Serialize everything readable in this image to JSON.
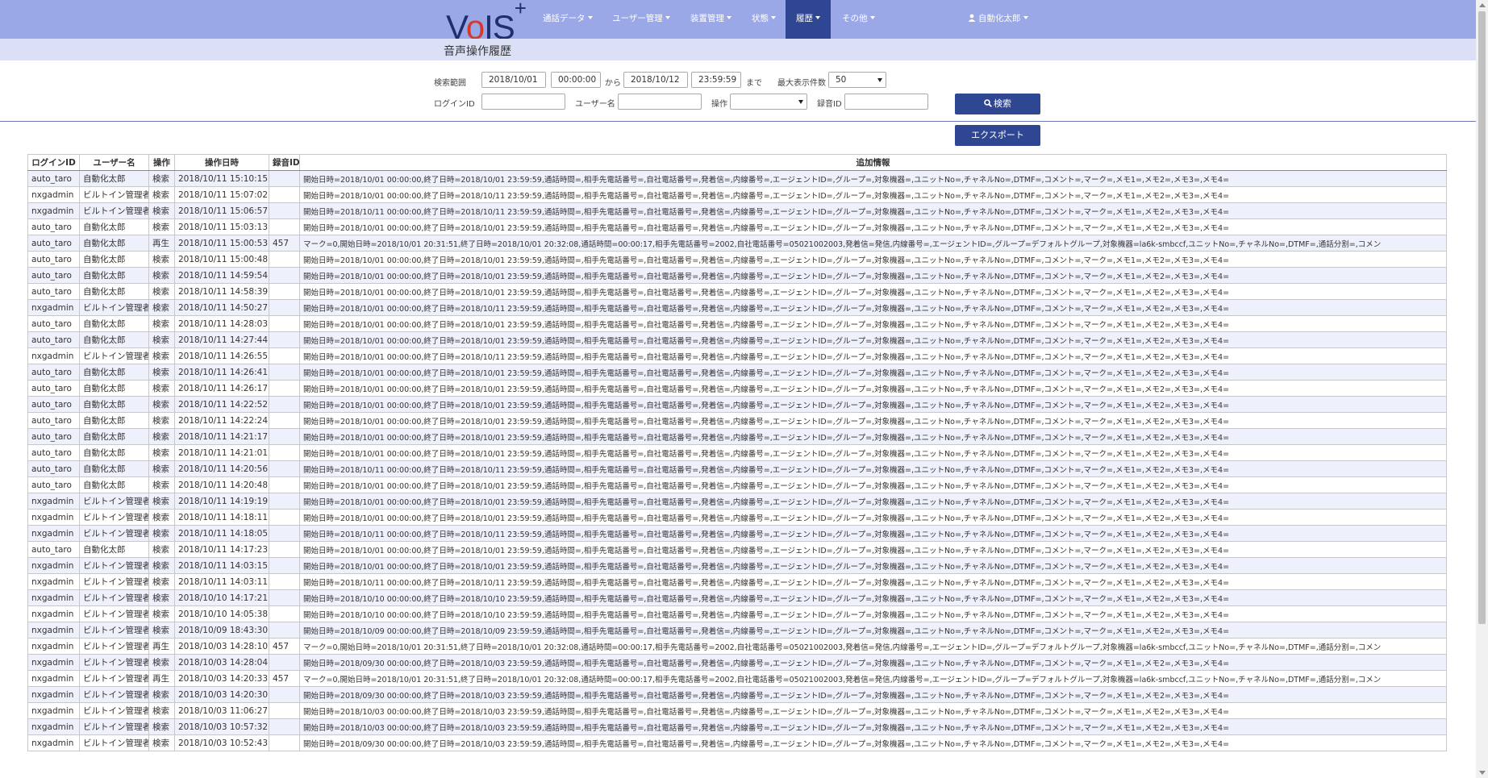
{
  "nav": {
    "logo": "VoIS",
    "logo_plus": "+",
    "menus": [
      "通話データ",
      "ユーザー管理",
      "装置管理",
      "状態",
      "履歴",
      "その他"
    ],
    "active_menu": "履歴",
    "user": "自動化太郎"
  },
  "page_title": "音声操作履歴",
  "search": {
    "range_label": "検索範囲",
    "from_date": "2018/10/01",
    "from_time": "00:00:00",
    "from_sep": "から",
    "to_date": "2018/10/12",
    "to_time": "23:59:59",
    "to_sep": "まで",
    "max_label": "最大表示件数",
    "max_value": "50",
    "login_label": "ログインID",
    "login_value": "",
    "user_label": "ユーザー名",
    "user_value": "",
    "op_label": "操作",
    "op_value": "",
    "rec_label": "録音ID",
    "rec_value": "",
    "search_button": "検索",
    "export_button": "エクスポート"
  },
  "table": {
    "columns": [
      "ログインID",
      "ユーザー名",
      "操作",
      "操作日時",
      "録音ID",
      "追加情報"
    ],
    "rows": [
      [
        "auto_taro",
        "自動化太郎",
        "検索",
        "2018/10/11 15:10:15",
        "",
        "開始日時=2018/10/01 00:00:00,終了日時=2018/10/01 23:59:59,通話時間=,相手先電話番号=,自社電話番号=,発着信=,内線番号=,エージェントID=,グループ=,対象機器=,ユニットNo=,チャネルNo=,DTMF=,コメント=,マーク=,メモ1=,メモ2=,メモ3=,メモ4="
      ],
      [
        "nxgadmin",
        "ビルトイン管理者",
        "検索",
        "2018/10/11 15:07:02",
        "",
        "開始日時=2018/10/01 00:00:00,終了日時=2018/10/11 23:59:59,通話時間=,相手先電話番号=,自社電話番号=,発着信=,内線番号=,エージェントID=,グループ=,対象機器=,ユニットNo=,チャネルNo=,DTMF=,コメント=,マーク=,メモ1=,メモ2=,メモ3=,メモ4="
      ],
      [
        "nxgadmin",
        "ビルトイン管理者",
        "検索",
        "2018/10/11 15:06:57",
        "",
        "開始日時=2018/10/11 00:00:00,終了日時=2018/10/11 23:59:59,通話時間=,相手先電話番号=,自社電話番号=,発着信=,内線番号=,エージェントID=,グループ=,対象機器=,ユニットNo=,チャネルNo=,DTMF=,コメント=,マーク=,メモ1=,メモ2=,メモ3=,メモ4="
      ],
      [
        "auto_taro",
        "自動化太郎",
        "検索",
        "2018/10/11 15:03:13",
        "",
        "開始日時=2018/10/01 00:00:00,終了日時=2018/10/01 23:59:59,通話時間=,相手先電話番号=,自社電話番号=,発着信=,内線番号=,エージェントID=,グループ=,対象機器=,ユニットNo=,チャネルNo=,DTMF=,コメント=,マーク=,メモ1=,メモ2=,メモ3=,メモ4="
      ],
      [
        "auto_taro",
        "自動化太郎",
        "再生",
        "2018/10/11 15:00:53",
        "457",
        "マーク=0,開始日時=2018/10/01 20:31:51,終了日時=2018/10/01 20:32:08,通話時間=00:00:17,相手先電話番号=2002,自社電話番号=05021002003,発着信=発信,内線番号=,エージェントID=,グループ=デフォルトグループ,対象機器=la6k-smbccf,ユニットNo=,チャネルNo=,DTMF=,通話分割=,コメン"
      ],
      [
        "auto_taro",
        "自動化太郎",
        "検索",
        "2018/10/11 15:00:48",
        "",
        "開始日時=2018/10/01 00:00:00,終了日時=2018/10/01 23:59:59,通話時間=,相手先電話番号=,自社電話番号=,発着信=,内線番号=,エージェントID=,グループ=,対象機器=,ユニットNo=,チャネルNo=,DTMF=,コメント=,マーク=,メモ1=,メモ2=,メモ3=,メモ4="
      ],
      [
        "auto_taro",
        "自動化太郎",
        "検索",
        "2018/10/11 14:59:54",
        "",
        "開始日時=2018/10/01 00:00:00,終了日時=2018/10/01 23:59:59,通話時間=,相手先電話番号=,自社電話番号=,発着信=,内線番号=,エージェントID=,グループ=,対象機器=,ユニットNo=,チャネルNo=,DTMF=,コメント=,マーク=,メモ1=,メモ2=,メモ3=,メモ4="
      ],
      [
        "auto_taro",
        "自動化太郎",
        "検索",
        "2018/10/11 14:58:39",
        "",
        "開始日時=2018/10/01 00:00:00,終了日時=2018/10/01 23:59:59,通話時間=,相手先電話番号=,自社電話番号=,発着信=,内線番号=,エージェントID=,グループ=,対象機器=,ユニットNo=,チャネルNo=,DTMF=,コメント=,マーク=,メモ1=,メモ2=,メモ3=,メモ4="
      ],
      [
        "nxgadmin",
        "ビルトイン管理者",
        "検索",
        "2018/10/11 14:50:27",
        "",
        "開始日時=2018/10/01 00:00:00,終了日時=2018/10/11 23:59:59,通話時間=,相手先電話番号=,自社電話番号=,発着信=,内線番号=,エージェントID=,グループ=,対象機器=,ユニットNo=,チャネルNo=,DTMF=,コメント=,マーク=,メモ1=,メモ2=,メモ3=,メモ4="
      ],
      [
        "auto_taro",
        "自動化太郎",
        "検索",
        "2018/10/11 14:28:03",
        "",
        "開始日時=2018/10/01 00:00:00,終了日時=2018/10/01 23:59:59,通話時間=,相手先電話番号=,自社電話番号=,発着信=,内線番号=,エージェントID=,グループ=,対象機器=,ユニットNo=,チャネルNo=,DTMF=,コメント=,マーク=,メモ1=,メモ2=,メモ3=,メモ4="
      ],
      [
        "auto_taro",
        "自動化太郎",
        "検索",
        "2018/10/11 14:27:44",
        "",
        "開始日時=2018/10/01 00:00:00,終了日時=2018/10/01 23:59:59,通話時間=,相手先電話番号=,自社電話番号=,発着信=,内線番号=,エージェントID=,グループ=,対象機器=,ユニットNo=,チャネルNo=,DTMF=,コメント=,マーク=,メモ1=,メモ2=,メモ3=,メモ4="
      ],
      [
        "nxgadmin",
        "ビルトイン管理者",
        "検索",
        "2018/10/11 14:26:55",
        "",
        "開始日時=2018/10/01 00:00:00,終了日時=2018/10/11 23:59:59,通話時間=,相手先電話番号=,自社電話番号=,発着信=,内線番号=,エージェントID=,グループ=,対象機器=,ユニットNo=,チャネルNo=,DTMF=,コメント=,マーク=,メモ1=,メモ2=,メモ3=,メモ4="
      ],
      [
        "auto_taro",
        "自動化太郎",
        "検索",
        "2018/10/11 14:26:41",
        "",
        "開始日時=2018/10/01 00:00:00,終了日時=2018/10/01 23:59:59,通話時間=,相手先電話番号=,自社電話番号=,発着信=,内線番号=,エージェントID=,グループ=,対象機器=,ユニットNo=,チャネルNo=,DTMF=,コメント=,マーク=,メモ1=,メモ2=,メモ3=,メモ4="
      ],
      [
        "auto_taro",
        "自動化太郎",
        "検索",
        "2018/10/11 14:26:17",
        "",
        "開始日時=2018/10/01 00:00:00,終了日時=2018/10/01 23:59:59,通話時間=,相手先電話番号=,自社電話番号=,発着信=,内線番号=,エージェントID=,グループ=,対象機器=,ユニットNo=,チャネルNo=,DTMF=,コメント=,マーク=,メモ1=,メモ2=,メモ3=,メモ4="
      ],
      [
        "auto_taro",
        "自動化太郎",
        "検索",
        "2018/10/11 14:22:52",
        "",
        "開始日時=2018/10/01 00:00:00,終了日時=2018/10/01 23:59:59,通話時間=,相手先電話番号=,自社電話番号=,発着信=,内線番号=,エージェントID=,グループ=,対象機器=,ユニットNo=,チャネルNo=,DTMF=,コメント=,マーク=,メモ1=,メモ2=,メモ3=,メモ4="
      ],
      [
        "auto_taro",
        "自動化太郎",
        "検索",
        "2018/10/11 14:22:24",
        "",
        "開始日時=2018/10/01 00:00:00,終了日時=2018/10/01 23:59:59,通話時間=,相手先電話番号=,自社電話番号=,発着信=,内線番号=,エージェントID=,グループ=,対象機器=,ユニットNo=,チャネルNo=,DTMF=,コメント=,マーク=,メモ1=,メモ2=,メモ3=,メモ4="
      ],
      [
        "auto_taro",
        "自動化太郎",
        "検索",
        "2018/10/11 14:21:17",
        "",
        "開始日時=2018/10/01 00:00:00,終了日時=2018/10/01 23:59:59,通話時間=,相手先電話番号=,自社電話番号=,発着信=,内線番号=,エージェントID=,グループ=,対象機器=,ユニットNo=,チャネルNo=,DTMF=,コメント=,マーク=,メモ1=,メモ2=,メモ3=,メモ4="
      ],
      [
        "auto_taro",
        "自動化太郎",
        "検索",
        "2018/10/11 14:21:01",
        "",
        "開始日時=2018/10/01 00:00:00,終了日時=2018/10/01 23:59:59,通話時間=,相手先電話番号=,自社電話番号=,発着信=,内線番号=,エージェントID=,グループ=,対象機器=,ユニットNo=,チャネルNo=,DTMF=,コメント=,マーク=,メモ1=,メモ2=,メモ3=,メモ4="
      ],
      [
        "auto_taro",
        "自動化太郎",
        "検索",
        "2018/10/11 14:20:56",
        "",
        "開始日時=2018/10/11 00:00:00,終了日時=2018/10/11 23:59:59,通話時間=,相手先電話番号=,自社電話番号=,発着信=,内線番号=,エージェントID=,グループ=,対象機器=,ユニットNo=,チャネルNo=,DTMF=,コメント=,マーク=,メモ1=,メモ2=,メモ3=,メモ4="
      ],
      [
        "auto_taro",
        "自動化太郎",
        "検索",
        "2018/10/11 14:20:48",
        "",
        "開始日時=2018/10/01 00:00:00,終了日時=2018/10/01 23:59:59,通話時間=,相手先電話番号=,自社電話番号=,発着信=,内線番号=,エージェントID=,グループ=,対象機器=,ユニットNo=,チャネルNo=,DTMF=,コメント=,マーク=,メモ1=,メモ2=,メモ3=,メモ4="
      ],
      [
        "nxgadmin",
        "ビルトイン管理者",
        "検索",
        "2018/10/11 14:19:19",
        "",
        "開始日時=2018/10/01 00:00:00,終了日時=2018/10/01 23:59:59,通話時間=,相手先電話番号=,自社電話番号=,発着信=,内線番号=,エージェントID=,グループ=,対象機器=,ユニットNo=,チャネルNo=,DTMF=,コメント=,マーク=,メモ1=,メモ2=,メモ3=,メモ4="
      ],
      [
        "nxgadmin",
        "ビルトイン管理者",
        "検索",
        "2018/10/11 14:18:11",
        "",
        "開始日時=2018/10/01 00:00:00,終了日時=2018/10/01 23:59:59,通話時間=,相手先電話番号=,自社電話番号=,発着信=,内線番号=,エージェントID=,グループ=,対象機器=,ユニットNo=,チャネルNo=,DTMF=,コメント=,マーク=,メモ1=,メモ2=,メモ3=,メモ4="
      ],
      [
        "nxgadmin",
        "ビルトイン管理者",
        "検索",
        "2018/10/11 14:18:05",
        "",
        "開始日時=2018/10/11 00:00:00,終了日時=2018/10/11 23:59:59,通話時間=,相手先電話番号=,自社電話番号=,発着信=,内線番号=,エージェントID=,グループ=,対象機器=,ユニットNo=,チャネルNo=,DTMF=,コメント=,マーク=,メモ1=,メモ2=,メモ3=,メモ4="
      ],
      [
        "auto_taro",
        "自動化太郎",
        "検索",
        "2018/10/11 14:17:23",
        "",
        "開始日時=2018/10/01 00:00:00,終了日時=2018/10/01 23:59:59,通話時間=,相手先電話番号=,自社電話番号=,発着信=,内線番号=,エージェントID=,グループ=,対象機器=,ユニットNo=,チャネルNo=,DTMF=,コメント=,マーク=,メモ1=,メモ2=,メモ3=,メモ4="
      ],
      [
        "nxgadmin",
        "ビルトイン管理者",
        "検索",
        "2018/10/11 14:03:15",
        "",
        "開始日時=2018/10/01 00:00:00,終了日時=2018/10/01 23:59:59,通話時間=,相手先電話番号=,自社電話番号=,発着信=,内線番号=,エージェントID=,グループ=,対象機器=,ユニットNo=,チャネルNo=,DTMF=,コメント=,マーク=,メモ1=,メモ2=,メモ3=,メモ4="
      ],
      [
        "nxgadmin",
        "ビルトイン管理者",
        "検索",
        "2018/10/11 14:03:11",
        "",
        "開始日時=2018/10/11 00:00:00,終了日時=2018/10/11 23:59:59,通話時間=,相手先電話番号=,自社電話番号=,発着信=,内線番号=,エージェントID=,グループ=,対象機器=,ユニットNo=,チャネルNo=,DTMF=,コメント=,マーク=,メモ1=,メモ2=,メモ3=,メモ4="
      ],
      [
        "nxgadmin",
        "ビルトイン管理者",
        "検索",
        "2018/10/10 14:17:21",
        "",
        "開始日時=2018/10/10 00:00:00,終了日時=2018/10/10 23:59:59,通話時間=,相手先電話番号=,自社電話番号=,発着信=,内線番号=,エージェントID=,グループ=,対象機器=,ユニットNo=,チャネルNo=,DTMF=,コメント=,マーク=,メモ1=,メモ2=,メモ3=,メモ4="
      ],
      [
        "nxgadmin",
        "ビルトイン管理者",
        "検索",
        "2018/10/10 14:05:38",
        "",
        "開始日時=2018/10/10 00:00:00,終了日時=2018/10/10 23:59:59,通話時間=,相手先電話番号=,自社電話番号=,発着信=,内線番号=,エージェントID=,グループ=,対象機器=,ユニットNo=,チャネルNo=,DTMF=,コメント=,マーク=,メモ1=,メモ2=,メモ3=,メモ4="
      ],
      [
        "nxgadmin",
        "ビルトイン管理者",
        "検索",
        "2018/10/09 18:43:30",
        "",
        "開始日時=2018/10/09 00:00:00,終了日時=2018/10/09 23:59:59,通話時間=,相手先電話番号=,自社電話番号=,発着信=,内線番号=,エージェントID=,グループ=,対象機器=,ユニットNo=,チャネルNo=,DTMF=,コメント=,マーク=,メモ1=,メモ2=,メモ3=,メモ4="
      ],
      [
        "nxgadmin",
        "ビルトイン管理者",
        "再生",
        "2018/10/03 14:28:10",
        "457",
        "マーク=0,開始日時=2018/10/01 20:31:51,終了日時=2018/10/01 20:32:08,通話時間=00:00:17,相手先電話番号=2002,自社電話番号=05021002003,発着信=発信,内線番号=,エージェントID=,グループ=デフォルトグループ,対象機器=la6k-smbccf,ユニットNo=,チャネルNo=,DTMF=,通話分割=,コメン"
      ],
      [
        "nxgadmin",
        "ビルトイン管理者",
        "検索",
        "2018/10/03 14:28:04",
        "",
        "開始日時=2018/09/30 00:00:00,終了日時=2018/10/03 23:59:59,通話時間=,相手先電話番号=,自社電話番号=,発着信=,内線番号=,エージェントID=,グループ=,対象機器=,ユニットNo=,チャネルNo=,DTMF=,コメント=,マーク=,メモ1=,メモ2=,メモ3=,メモ4="
      ],
      [
        "nxgadmin",
        "ビルトイン管理者",
        "再生",
        "2018/10/03 14:20:33",
        "457",
        "マーク=0,開始日時=2018/10/01 20:31:51,終了日時=2018/10/01 20:32:08,通話時間=00:00:17,相手先電話番号=2002,自社電話番号=05021002003,発着信=発信,内線番号=,エージェントID=,グループ=デフォルトグループ,対象機器=la6k-smbccf,ユニットNo=,チャネルNo=,DTMF=,通話分割=,コメン"
      ],
      [
        "nxgadmin",
        "ビルトイン管理者",
        "検索",
        "2018/10/03 14:20:30",
        "",
        "開始日時=2018/09/30 00:00:00,終了日時=2018/10/03 23:59:59,通話時間=,相手先電話番号=,自社電話番号=,発着信=,内線番号=,エージェントID=,グループ=,対象機器=,ユニットNo=,チャネルNo=,DTMF=,コメント=,マーク=,メモ1=,メモ2=,メモ3=,メモ4="
      ],
      [
        "nxgadmin",
        "ビルトイン管理者",
        "検索",
        "2018/10/03 11:06:27",
        "",
        "開始日時=2018/10/03 00:00:00,終了日時=2018/10/03 23:59:59,通話時間=,相手先電話番号=,自社電話番号=,発着信=,内線番号=,エージェントID=,グループ=,対象機器=,ユニットNo=,チャネルNo=,DTMF=,コメント=,マーク=,メモ1=,メモ2=,メモ3=,メモ4="
      ],
      [
        "nxgadmin",
        "ビルトイン管理者",
        "検索",
        "2018/10/03 10:57:32",
        "",
        "開始日時=2018/10/03 00:00:00,終了日時=2018/10/03 23:59:59,通話時間=,相手先電話番号=,自社電話番号=,発着信=,内線番号=,エージェントID=,グループ=,対象機器=,ユニットNo=,チャネルNo=,DTMF=,コメント=,マーク=,メモ1=,メモ2=,メモ3=,メモ4="
      ],
      [
        "nxgadmin",
        "ビルトイン管理者",
        "検索",
        "2018/10/03 10:52:43",
        "",
        "開始日時=2018/09/30 00:00:00,終了日時=2018/10/03 23:59:59,通話時間=,相手先電話番号=,自社電話番号=,発着信=,内線番号=,エージェントID=,グループ=,対象機器=,ユニットNo=,チャネルNo=,DTMF=,コメント=,マーク=,メモ1=,メモ2=,メモ3=,メモ4="
      ]
    ]
  },
  "colors": {
    "navbar": "#9aa8e8",
    "navbar_active": "#2f4792",
    "button": "#2f4792",
    "row_stripe": "#eef0fb"
  }
}
